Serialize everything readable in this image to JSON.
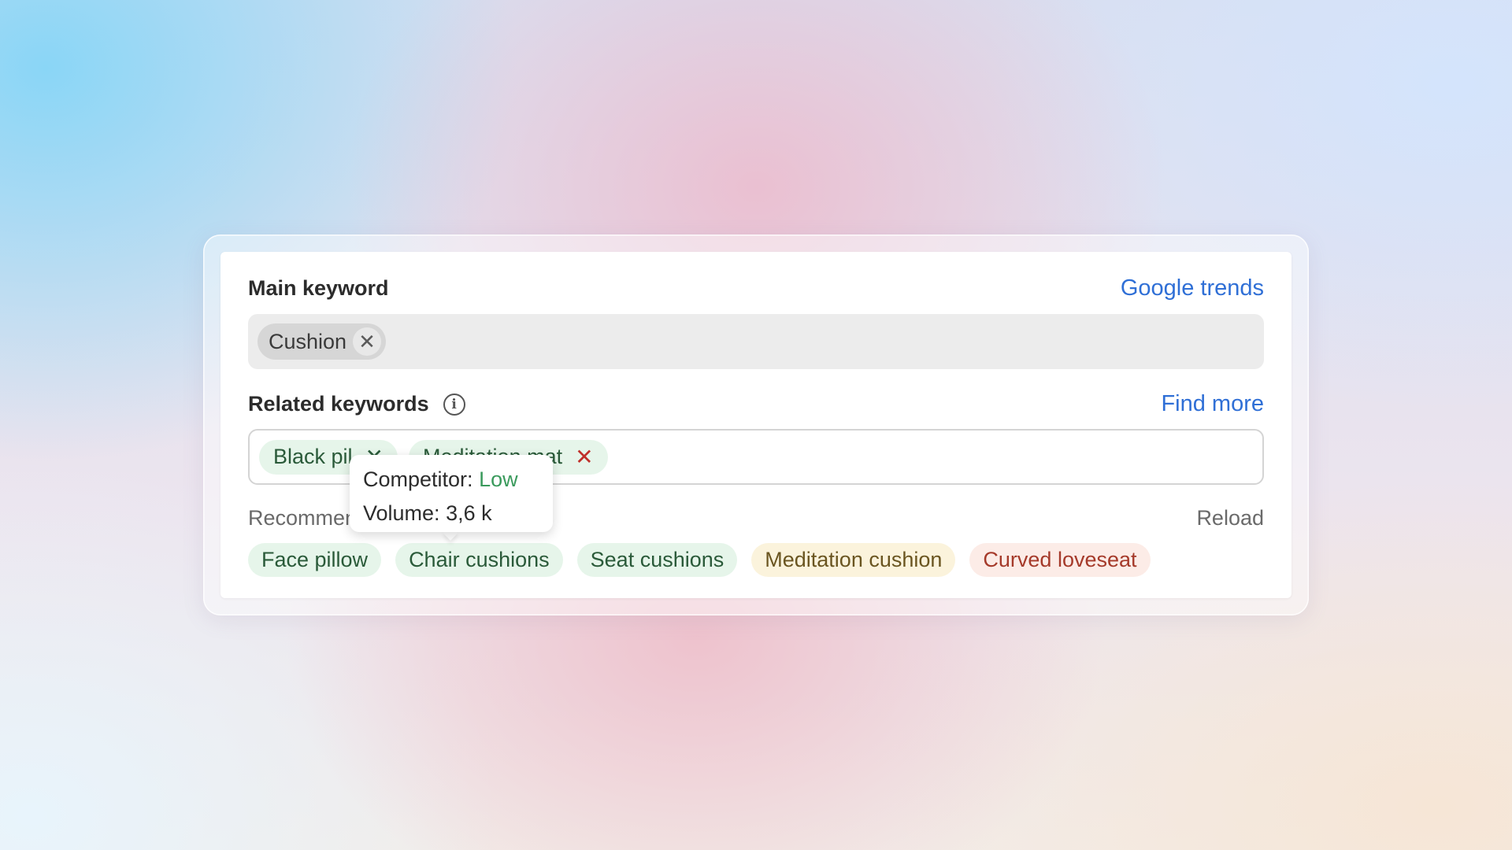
{
  "main_keyword": {
    "title": "Main keyword",
    "link": "Google trends",
    "chips": [
      {
        "label": "Cushion"
      }
    ]
  },
  "related_keywords": {
    "title": "Related keywords",
    "link": "Find more",
    "chips": [
      {
        "label": "Black pil"
      },
      {
        "label": "Meditation mat"
      }
    ]
  },
  "recommendations": {
    "label": "Recommen",
    "reload": "Reload",
    "items": [
      {
        "label": "Face pillow",
        "tone": "green"
      },
      {
        "label": "Chair cushions",
        "tone": "green"
      },
      {
        "label": "Seat cushions",
        "tone": "green"
      },
      {
        "label": "Meditation cushion",
        "tone": "yellow"
      },
      {
        "label": "Curved loveseat",
        "tone": "red"
      }
    ]
  },
  "tooltip": {
    "competitor_label": "Competitor:",
    "competitor_value": "Low",
    "volume_label": "Volume:",
    "volume_value": "3,6 k"
  },
  "icons": {
    "remove": "close-icon",
    "info": "info-icon",
    "dropdown": "chevron-down-icon"
  },
  "colors": {
    "link": "#2f6fd6",
    "green_chip_bg": "#e6f5ea",
    "green_chip_text": "#2a5a39",
    "yellow_chip_bg": "#fbf3dc",
    "red_chip_bg": "#fcece7",
    "remove_red": "#c0302a",
    "competitor_low": "#3a9a5c"
  }
}
